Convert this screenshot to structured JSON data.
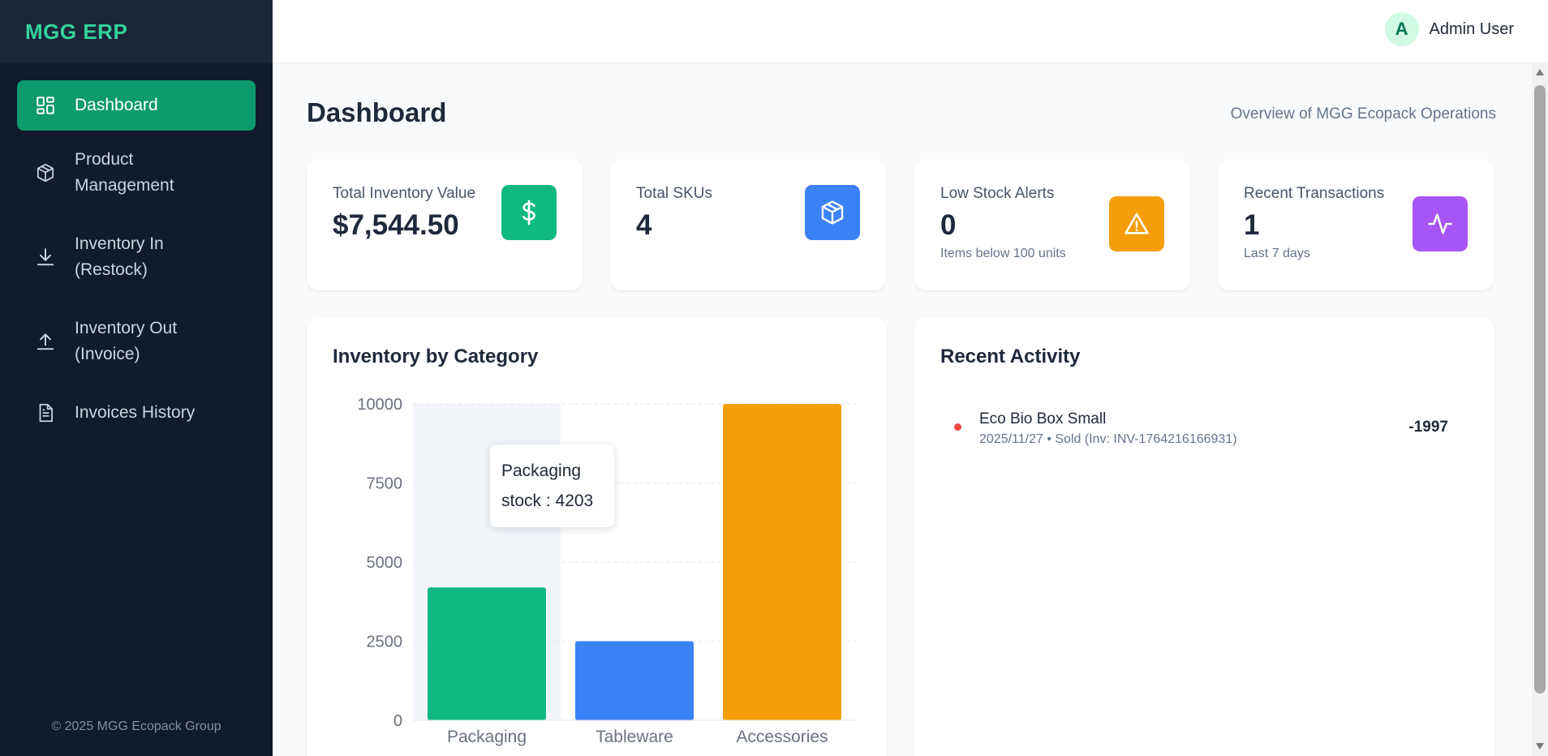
{
  "app": {
    "brand": "MGG ERP",
    "footer": "© 2025 MGG Ecopack Group"
  },
  "sidebar": {
    "items": [
      {
        "label": "Dashboard",
        "icon": "dashboard-grid-icon",
        "active": true
      },
      {
        "label": "Product Management",
        "icon": "box-icon",
        "active": false
      },
      {
        "label": "Inventory In (Restock)",
        "icon": "download-icon",
        "active": false
      },
      {
        "label": "Inventory Out (Invoice)",
        "icon": "upload-icon",
        "active": false
      },
      {
        "label": "Invoices History",
        "icon": "file-text-icon",
        "active": false
      }
    ]
  },
  "topbar": {
    "avatar_letter": "A",
    "user_name": "Admin User"
  },
  "page": {
    "title": "Dashboard",
    "subtitle": "Overview of MGG Ecopack Operations"
  },
  "stats": [
    {
      "label": "Total Inventory Value",
      "value": "$7,544.50",
      "sub": "",
      "icon": "dollar-icon",
      "color": "#10b981"
    },
    {
      "label": "Total SKUs",
      "value": "4",
      "sub": "",
      "icon": "box-icon",
      "color": "#3b82f6"
    },
    {
      "label": "Low Stock Alerts",
      "value": "0",
      "sub": "Items below 100 units",
      "icon": "alert-triangle-icon",
      "color": "#f59e0b"
    },
    {
      "label": "Recent Transactions",
      "value": "1",
      "sub": "Last 7 days",
      "icon": "activity-icon",
      "color": "#a855f7"
    }
  ],
  "chart_panel": {
    "title": "Inventory by Category"
  },
  "chart_data": {
    "type": "bar",
    "categories": [
      "Packaging",
      "Tableware",
      "Accessories"
    ],
    "series": [
      {
        "name": "stock",
        "values": [
          4203,
          2500,
          10000
        ]
      }
    ],
    "colors": [
      "#10b981",
      "#3b82f6",
      "#f59e0b"
    ],
    "yticks": [
      0,
      2500,
      5000,
      7500,
      10000
    ],
    "ylim": [
      0,
      10000
    ],
    "grid": true,
    "tooltip": {
      "category": "Packaging",
      "line": "stock : 4203"
    }
  },
  "activity_panel": {
    "title": "Recent Activity",
    "items": [
      {
        "name": "Eco Bio Box Small",
        "meta": "2025/11/27 • Sold (Inv: INV-1764216166931)",
        "qty": "-1997"
      }
    ]
  }
}
